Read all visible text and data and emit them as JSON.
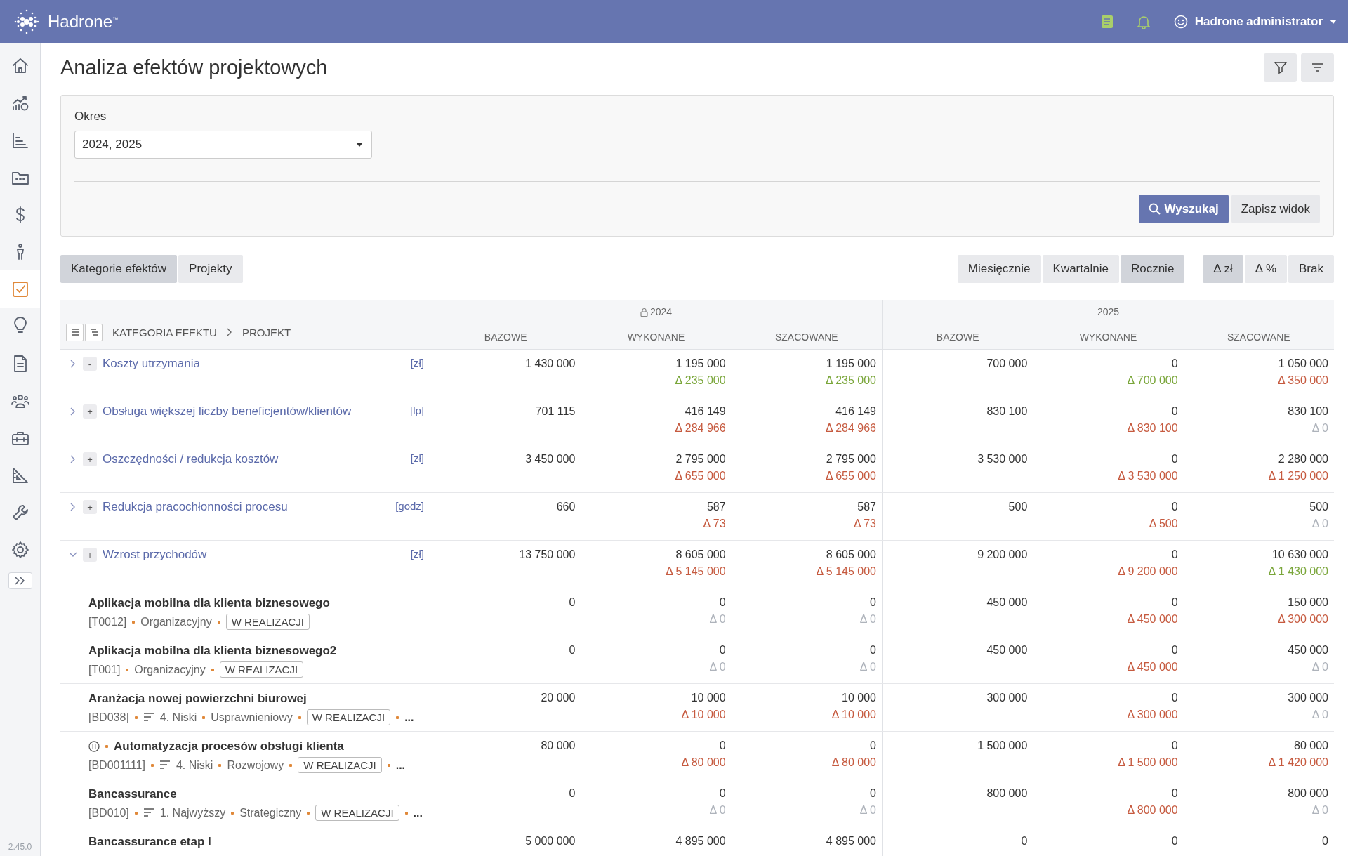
{
  "app": {
    "brand": "Hadrone",
    "brand_mark": "™",
    "user": "Hadrone administrator",
    "version": "2.45.0"
  },
  "sidebar": {
    "items": [
      {
        "selected": false
      },
      {
        "selected": false
      },
      {
        "selected": false
      },
      {
        "selected": false
      },
      {
        "selected": false
      },
      {
        "selected": false
      },
      {
        "selected": true
      },
      {
        "selected": false
      },
      {
        "selected": false
      },
      {
        "selected": false
      },
      {
        "selected": false
      },
      {
        "selected": false
      },
      {
        "selected": false
      },
      {
        "selected": false
      }
    ]
  },
  "page": {
    "title": "Analiza efektów projektowych"
  },
  "filters": {
    "period_label": "Okres",
    "period_value": "2024, 2025",
    "search_button": "Wyszukaj",
    "save_button": "Zapisz widok"
  },
  "view_tabs": [
    {
      "label": "Kategorie efektów",
      "selected": true
    },
    {
      "label": "Projekty",
      "selected": false
    }
  ],
  "granularity": [
    {
      "label": "Miesięcznie",
      "selected": false
    },
    {
      "label": "Kwartalnie",
      "selected": false
    },
    {
      "label": "Rocznie",
      "selected": true
    }
  ],
  "delta_mode": [
    {
      "label": "Δ zł",
      "selected": true
    },
    {
      "label": "Δ %",
      "selected": false
    },
    {
      "label": "Brak",
      "selected": false
    }
  ],
  "table": {
    "breadcrumb": [
      "KATEGORIA EFEKTU",
      "PROJEKT"
    ],
    "years": [
      {
        "label": "2024",
        "locked": true
      },
      {
        "label": "2025",
        "locked": false
      }
    ],
    "columns": [
      "BAZOWE",
      "WYKONANE",
      "SZACOWANE",
      "BAZOWE",
      "WYKONANE",
      "SZACOWANE"
    ],
    "rows": [
      {
        "kind": "category",
        "toggle": "-",
        "name": "Koszty utrzymania",
        "unit": "[zł]",
        "expanded": false,
        "cells": [
          {
            "value": "1 430 000"
          },
          {
            "value": "1 195 000",
            "delta": "Δ 235 000",
            "color": "#7aa63a"
          },
          {
            "value": "1 195 000",
            "delta": "Δ 235 000",
            "color": "#7aa63a"
          },
          {
            "value": "700 000"
          },
          {
            "value": "0",
            "delta": "Δ 700 000",
            "color": "#7aa63a"
          },
          {
            "value": "1 050 000",
            "delta": "Δ 350 000",
            "color": "#c65a3f"
          }
        ]
      },
      {
        "kind": "category",
        "toggle": "+",
        "name": "Obsługa większej liczby beneficjentów/klientów",
        "unit": "[lp]",
        "expanded": false,
        "cells": [
          {
            "value": "701 115"
          },
          {
            "value": "416 149",
            "delta": "Δ 284 966",
            "color": "#c65a3f"
          },
          {
            "value": "416 149",
            "delta": "Δ 284 966",
            "color": "#c65a3f"
          },
          {
            "value": "830 100"
          },
          {
            "value": "0",
            "delta": "Δ 830 100",
            "color": "#c65a3f"
          },
          {
            "value": "830 100",
            "delta": "Δ 0",
            "color": "#aeb3bb"
          }
        ]
      },
      {
        "kind": "category",
        "toggle": "+",
        "name": "Oszczędności / redukcja kosztów",
        "unit": "[zł]",
        "expanded": false,
        "cells": [
          {
            "value": "3 450 000"
          },
          {
            "value": "2 795 000",
            "delta": "Δ 655 000",
            "color": "#c65a3f"
          },
          {
            "value": "2 795 000",
            "delta": "Δ 655 000",
            "color": "#c65a3f"
          },
          {
            "value": "3 530 000"
          },
          {
            "value": "0",
            "delta": "Δ 3 530 000",
            "color": "#c65a3f"
          },
          {
            "value": "2 280 000",
            "delta": "Δ 1 250 000",
            "color": "#c65a3f"
          }
        ]
      },
      {
        "kind": "category",
        "toggle": "+",
        "name": "Redukcja pracochłonności procesu",
        "unit": "[godz]",
        "expanded": false,
        "cells": [
          {
            "value": "660"
          },
          {
            "value": "587",
            "delta": "Δ 73",
            "color": "#c65a3f"
          },
          {
            "value": "587",
            "delta": "Δ 73",
            "color": "#c65a3f"
          },
          {
            "value": "500"
          },
          {
            "value": "0",
            "delta": "Δ 500",
            "color": "#c65a3f"
          },
          {
            "value": "500",
            "delta": "Δ 0",
            "color": "#aeb3bb"
          }
        ]
      },
      {
        "kind": "category",
        "toggle": "+",
        "name": "Wzrost przychodów",
        "unit": "[zł]",
        "expanded": true,
        "cells": [
          {
            "value": "13 750 000"
          },
          {
            "value": "8 605 000",
            "delta": "Δ 5 145 000",
            "color": "#c65a3f"
          },
          {
            "value": "8 605 000",
            "delta": "Δ 5 145 000",
            "color": "#c65a3f"
          },
          {
            "value": "9 200 000"
          },
          {
            "value": "0",
            "delta": "Δ 9 200 000",
            "color": "#c65a3f"
          },
          {
            "value": "10 630 000",
            "delta": "Δ 1 430 000",
            "color": "#7aa63a"
          }
        ]
      },
      {
        "kind": "project",
        "paused": false,
        "name": "Aplikacja mobilna dla klienta biznesowego",
        "meta": [
          {
            "kind": "code",
            "text": "[T0012]"
          },
          {
            "kind": "type",
            "text": "Organizacyjny"
          },
          {
            "kind": "status",
            "text": "W REALIZACJI"
          }
        ],
        "cells": [
          {
            "value": "0"
          },
          {
            "value": "0",
            "delta": "Δ 0",
            "color": "#aeb3bb"
          },
          {
            "value": "0",
            "delta": "Δ 0",
            "color": "#aeb3bb"
          },
          {
            "value": "450 000"
          },
          {
            "value": "0",
            "delta": "Δ 450 000",
            "color": "#c65a3f"
          },
          {
            "value": "150 000",
            "delta": "Δ 300 000",
            "color": "#c65a3f"
          }
        ]
      },
      {
        "kind": "project",
        "paused": false,
        "name": "Aplikacja mobilna dla klienta biznesowego2",
        "meta": [
          {
            "kind": "code",
            "text": "[T001]"
          },
          {
            "kind": "type",
            "text": "Organizacyjny"
          },
          {
            "kind": "status",
            "text": "W REALIZACJI"
          }
        ],
        "cells": [
          {
            "value": "0"
          },
          {
            "value": "0",
            "delta": "Δ 0",
            "color": "#aeb3bb"
          },
          {
            "value": "0",
            "delta": "Δ 0",
            "color": "#aeb3bb"
          },
          {
            "value": "450 000"
          },
          {
            "value": "0",
            "delta": "Δ 450 000",
            "color": "#c65a3f"
          },
          {
            "value": "450 000",
            "delta": "Δ 0",
            "color": "#aeb3bb"
          }
        ]
      },
      {
        "kind": "project",
        "paused": false,
        "name": "Aranżacja nowej powierzchni biurowej",
        "meta": [
          {
            "kind": "code",
            "text": "[BD038]"
          },
          {
            "kind": "priority",
            "text": "4. Niski"
          },
          {
            "kind": "type",
            "text": "Usprawnieniowy"
          },
          {
            "kind": "status",
            "text": "W REALIZACJI"
          },
          {
            "kind": "more",
            "text": "..."
          }
        ],
        "cells": [
          {
            "value": "20 000"
          },
          {
            "value": "10 000",
            "delta": "Δ 10 000",
            "color": "#c65a3f"
          },
          {
            "value": "10 000",
            "delta": "Δ 10 000",
            "color": "#c65a3f"
          },
          {
            "value": "300 000"
          },
          {
            "value": "0",
            "delta": "Δ 300 000",
            "color": "#c65a3f"
          },
          {
            "value": "300 000",
            "delta": "Δ 0",
            "color": "#aeb3bb"
          }
        ]
      },
      {
        "kind": "project",
        "paused": true,
        "name": "Automatyzacja procesów obsługi klienta",
        "meta": [
          {
            "kind": "code",
            "text": "[BD001111]"
          },
          {
            "kind": "priority",
            "text": "4. Niski"
          },
          {
            "kind": "type",
            "text": "Rozwojowy"
          },
          {
            "kind": "status",
            "text": "W REALIZACJI"
          },
          {
            "kind": "more",
            "text": "..."
          }
        ],
        "cells": [
          {
            "value": "80 000"
          },
          {
            "value": "0",
            "delta": "Δ 80 000",
            "color": "#c65a3f"
          },
          {
            "value": "0",
            "delta": "Δ 80 000",
            "color": "#c65a3f"
          },
          {
            "value": "1 500 000"
          },
          {
            "value": "0",
            "delta": "Δ 1 500 000",
            "color": "#c65a3f"
          },
          {
            "value": "80 000",
            "delta": "Δ 1 420 000",
            "color": "#c65a3f"
          }
        ]
      },
      {
        "kind": "project",
        "paused": false,
        "name": "Bancassurance",
        "meta": [
          {
            "kind": "code",
            "text": "[BD010]"
          },
          {
            "kind": "priority",
            "text": "1. Najwyższy"
          },
          {
            "kind": "type",
            "text": "Strategiczny"
          },
          {
            "kind": "status",
            "text": "W REALIZACJI"
          },
          {
            "kind": "more",
            "text": "..."
          }
        ],
        "cells": [
          {
            "value": "0"
          },
          {
            "value": "0",
            "delta": "Δ 0",
            "color": "#aeb3bb"
          },
          {
            "value": "0",
            "delta": "Δ 0",
            "color": "#aeb3bb"
          },
          {
            "value": "800 000"
          },
          {
            "value": "0",
            "delta": "Δ 800 000",
            "color": "#c65a3f"
          },
          {
            "value": "800 000",
            "delta": "Δ 0",
            "color": "#aeb3bb"
          }
        ]
      },
      {
        "kind": "project",
        "paused": false,
        "name": "Bancassurance etap I",
        "meta": [],
        "cells": [
          {
            "value": "5 000 000"
          },
          {
            "value": "4 895 000"
          },
          {
            "value": "4 895 000"
          },
          {
            "value": "0"
          },
          {
            "value": "0"
          },
          {
            "value": "0"
          }
        ]
      }
    ]
  }
}
